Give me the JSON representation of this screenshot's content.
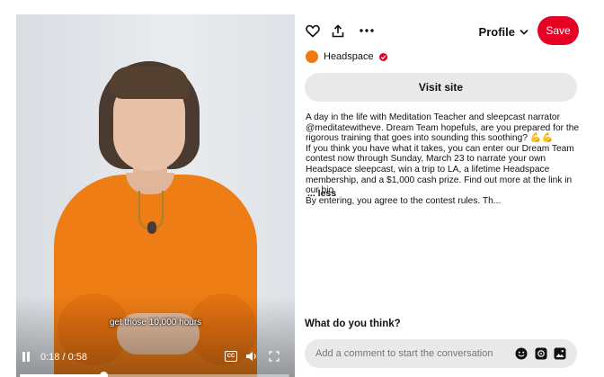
{
  "video": {
    "caption": "get those 10,000 hours",
    "current_time": "0:18",
    "duration": "/ 0:58",
    "progress_fraction": 0.31
  },
  "toolbar": {
    "profile_label": "Profile",
    "save_label": "Save"
  },
  "creator": {
    "name": "Headspace",
    "avatar_color": "#f07a10",
    "verified": true
  },
  "visit_site_label": "Visit site",
  "description": {
    "lines": [
      "A day in the life with Meditation Teacher and sleepcast narrator @meditatewitheve. Dream Team hopefuls, are you prepared for the rigorous training that goes into sounding this soothing? 💪💪",
      "If you think you have what it takes, you can enter our Dream Team contest now through Sunday, March 23 to narrate your own Headspace sleepcast, win a trip to LA, a lifetime Headspace membership, and a $1,000 cash prize. Find out more at the link in our bio.",
      "By entering, you agree to the contest rules. Th..."
    ],
    "less_label": "... less"
  },
  "comments": {
    "title": "What do you think?",
    "placeholder": "Add a comment to start the conversation"
  },
  "icons": [
    "heart-icon",
    "share-icon",
    "more-icon",
    "chevron-down-icon",
    "verified-icon",
    "pause-icon",
    "captions-icon",
    "volume-icon",
    "fullscreen-icon",
    "emoji-icon",
    "sticker-icon",
    "image-icon"
  ],
  "colors": {
    "brand_red": "#e60023",
    "button_gray": "#e9e9e9",
    "sweater_orange": "#ee7d16"
  }
}
